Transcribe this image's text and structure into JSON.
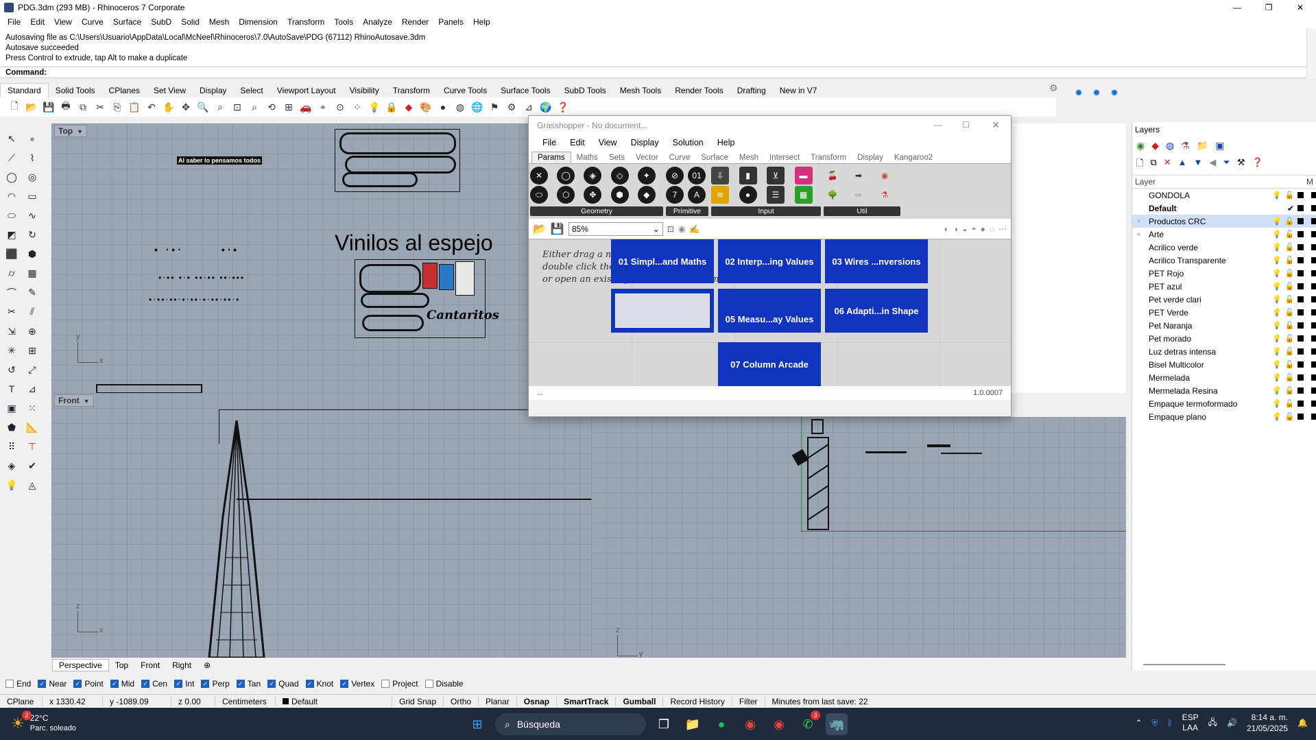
{
  "window": {
    "title": "PDG.3dm (293 MB) - Rhinoceros 7 Corporate",
    "minimize": "—",
    "maximize": "❐",
    "close": "✕"
  },
  "menu": [
    "File",
    "Edit",
    "View",
    "Curve",
    "Surface",
    "SubD",
    "Solid",
    "Mesh",
    "Dimension",
    "Transform",
    "Tools",
    "Analyze",
    "Render",
    "Panels",
    "Help"
  ],
  "command_history": [
    "Autosaving file as C:\\Users\\Usuario\\AppData\\Local\\McNeel\\Rhinoceros\\7.0\\AutoSave\\PDG (67112) RhinoAutosave.3dm",
    "Autosave succeeded",
    "Press Control to extrude, tap Alt to make a duplicate"
  ],
  "command_prompt": "Command:",
  "toolbar_tabs": [
    "Standard",
    "Solid Tools",
    "CPlanes",
    "Set View",
    "Display",
    "Select",
    "Viewport Layout",
    "Visibility",
    "Transform",
    "Curve Tools",
    "Surface Tools",
    "SubD Tools",
    "Mesh Tools",
    "Render Tools",
    "Drafting",
    "New in V7"
  ],
  "viewports": {
    "top": {
      "label": "Top",
      "heading_text": "Vinilos al espejo",
      "small_text": "Al saber lo pensamos todos",
      "axis_x": "x",
      "axis_y": "y"
    },
    "front": {
      "label": "Front",
      "axis_x": "x",
      "axis_z": "z"
    },
    "right": {
      "axis_y": "y",
      "axis_z": "z"
    }
  },
  "grasshopper": {
    "title": "Grasshopper - No document...",
    "menu": [
      "File",
      "Edit",
      "View",
      "Display",
      "Solution",
      "Help"
    ],
    "tabs": [
      "Params",
      "Maths",
      "Sets",
      "Vector",
      "Curve",
      "Surface",
      "Mesh",
      "Intersect",
      "Transform",
      "Display",
      "Kangaroo2"
    ],
    "groups": [
      "Geometry",
      "Primitive",
      "Input",
      "Util"
    ],
    "zoom": "85%",
    "help_lines": [
      "Either drag a n",
      "double click the",
      "or open an existing document via the menu or the tiles."
    ],
    "tiles": [
      "01 Simpl...and Maths",
      "02 Interp...ing Values",
      "03 Wires ...nversions",
      "05 Measu...ay Values",
      "06 Adapti...in Shape",
      "07 Column Arcade"
    ],
    "status_left": "...",
    "version": "1.0.0007"
  },
  "layers": {
    "panel_title": "Layers",
    "col_layer": "Layer",
    "col_m": "M",
    "items": [
      {
        "name": "GONDOLA",
        "bold": false
      },
      {
        "name": "Default",
        "bold": true,
        "current": true
      },
      {
        "name": "Productos CRC",
        "bold": false,
        "selected": true,
        "expandable": true
      },
      {
        "name": "Arte",
        "bold": false,
        "expandable": true
      },
      {
        "name": "Acrilico verde"
      },
      {
        "name": "Acrilico Transparente"
      },
      {
        "name": "PET Rojo"
      },
      {
        "name": "PET azul"
      },
      {
        "name": "Pet verde clari"
      },
      {
        "name": "PET Verde"
      },
      {
        "name": "Pet Naranja"
      },
      {
        "name": "Pet morado"
      },
      {
        "name": "Luz detras intensa"
      },
      {
        "name": "Bisel Multicolor"
      },
      {
        "name": "Mermelada"
      },
      {
        "name": "Mermelada Resina"
      },
      {
        "name": "Empaque termoformado"
      },
      {
        "name": "Empaque plano"
      }
    ]
  },
  "viewport_tabs": [
    "Perspective",
    "Top",
    "Front",
    "Right",
    "⊕"
  ],
  "osnaps": [
    {
      "label": "End",
      "on": false
    },
    {
      "label": "Near",
      "on": true
    },
    {
      "label": "Point",
      "on": true
    },
    {
      "label": "Mid",
      "on": true
    },
    {
      "label": "Cen",
      "on": true
    },
    {
      "label": "Int",
      "on": true
    },
    {
      "label": "Perp",
      "on": true
    },
    {
      "label": "Tan",
      "on": true
    },
    {
      "label": "Quad",
      "on": true
    },
    {
      "label": "Knot",
      "on": true
    },
    {
      "label": "Vertex",
      "on": true
    },
    {
      "label": "Project",
      "on": false
    },
    {
      "label": "Disable",
      "on": false
    }
  ],
  "status": {
    "cplane": "CPlane",
    "x": "x 1330.42",
    "y": "y -1089.09",
    "z": "z 0.00",
    "units": "Centimeters",
    "layer": "Default",
    "grid_snap": "Grid Snap",
    "ortho": "Ortho",
    "planar": "Planar",
    "osnap": "Osnap",
    "smarttrack": "SmartTrack",
    "gumball": "Gumball",
    "record_history": "Record History",
    "filter": "Filter",
    "save_info": "Minutes from last save: 22"
  },
  "taskbar": {
    "temp": "22°C",
    "weather": "Parc. soleado",
    "weather_badge": "2",
    "search": "Búsqueda",
    "lang1": "ESP",
    "lang2": "LAA",
    "time": "8:14 a. m.",
    "date": "21/05/2025",
    "whatsapp_badge": "3"
  }
}
